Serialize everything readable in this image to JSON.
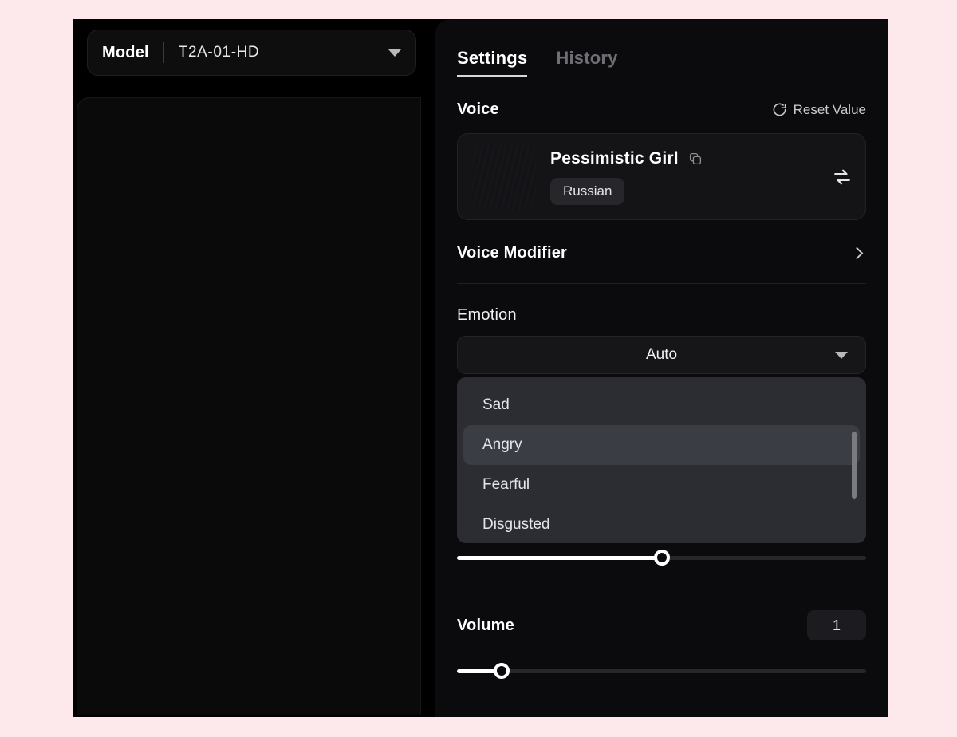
{
  "window": {
    "background_color": "#fde9ec",
    "app_background": "#000000"
  },
  "left_panel": {
    "model_selector": {
      "label": "Model",
      "value": "T2A-01-HD",
      "caret_icon": "chevron-down-icon"
    }
  },
  "right_panel": {
    "tabs": [
      {
        "label": "Settings",
        "active": true
      },
      {
        "label": "History",
        "active": false
      }
    ],
    "voice_section": {
      "title": "Voice",
      "reset": {
        "label": "Reset Value",
        "icon": "reset-icon"
      },
      "card": {
        "name": "Pessimistic Girl",
        "copy_icon": "copy-icon",
        "language": "Russian",
        "swap_icon": "swap-icon",
        "avatar_colors": [
          "#f08b55",
          "#f3ece3",
          "#4a7c8c"
        ]
      }
    },
    "voice_modifier": {
      "label": "Voice Modifier",
      "chevron_icon": "chevron-right-icon"
    },
    "emotion": {
      "label": "Emotion",
      "selected": "Auto",
      "caret_icon": "chevron-down-icon",
      "dropdown_open": true,
      "options": [
        {
          "label": "Sad",
          "selected": false
        },
        {
          "label": "Angry",
          "selected": true
        },
        {
          "label": "Fearful",
          "selected": false
        },
        {
          "label": "Disgusted",
          "selected": false
        }
      ],
      "slider_percent": 50
    },
    "volume": {
      "label": "Volume",
      "value": "1",
      "slider_percent": 11
    }
  }
}
